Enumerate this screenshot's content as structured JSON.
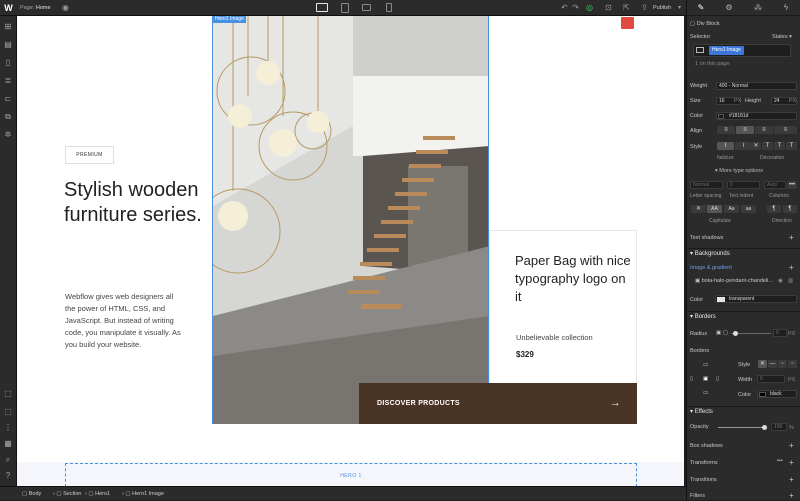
{
  "topbar": {
    "page_label": "Page:",
    "page_name": "Home",
    "publish_label": "Publish"
  },
  "canvas": {
    "premium_label": "PREMIUM",
    "heading": "Stylish wooden furniture series.",
    "body": "Webflow gives web designers all the power of HTML, CSS, and JavaScript. But instead of writing code, you manipulate it visually. As you build your website.",
    "hero_image_tag": "Hero1 Image",
    "card_title": "Paper Bag with nice typography logo on it",
    "card_subtitle": "Unbelievable collection",
    "card_price": "$329",
    "cta_label": "DISCOVER PRODUCTS",
    "cta_arrow": "→",
    "hero1_label": "HERO 1"
  },
  "breadcrumb": [
    "Body",
    "Section",
    "Hero1",
    "Hero1 Image"
  ],
  "panel": {
    "element_type": "Div Block",
    "selector_label": "Selector",
    "states_label": "States",
    "selector_class": "Hero1 Image",
    "on_page": "1 on this page",
    "weight_label": "Weight",
    "weight_value": "400 - Normal",
    "size_label": "Size",
    "size_value": "16",
    "size_unit": "PX",
    "height_label": "Height",
    "height_value": "24",
    "height_unit": "PX",
    "color_label": "Color",
    "color_value": "#18181d",
    "align_label": "Align",
    "style_label": "Style",
    "italicize_label": "Italicize",
    "decoration_label": "Decoration",
    "more_type": "More type options",
    "letter_spacing_value": "Normal",
    "text_indent_value": "0",
    "columns_value": "Auto",
    "letter_spacing_label": "Letter spacing",
    "text_indent_label": "Text indent",
    "columns_label": "Columns",
    "capitalize_label": "Capitalize",
    "direction_label": "Direction",
    "text_shadows_label": "Text shadows",
    "backgrounds_label": "Backgrounds",
    "image_gradient_label": "Image & gradient",
    "bg_file": "bola-halo-pendant-chandeli...",
    "bg_color_label": "Color",
    "bg_color_value": "transparent",
    "borders_label": "Borders",
    "radius_label": "Radius",
    "radius_value": "0",
    "radius_unit": "PX",
    "borders_sub_label": "Borders",
    "border_style_label": "Style",
    "border_width_label": "Width",
    "border_width_value": "0",
    "border_width_unit": "PX",
    "border_color_label": "Color",
    "border_color_value": "black",
    "effects_label": "Effects",
    "opacity_label": "Opacity",
    "opacity_value": "100",
    "opacity_unit": "%",
    "box_shadows_label": "Box shadows",
    "transforms_label": "Transforms",
    "transitions_label": "Transitions",
    "filters_label": "Filters"
  }
}
